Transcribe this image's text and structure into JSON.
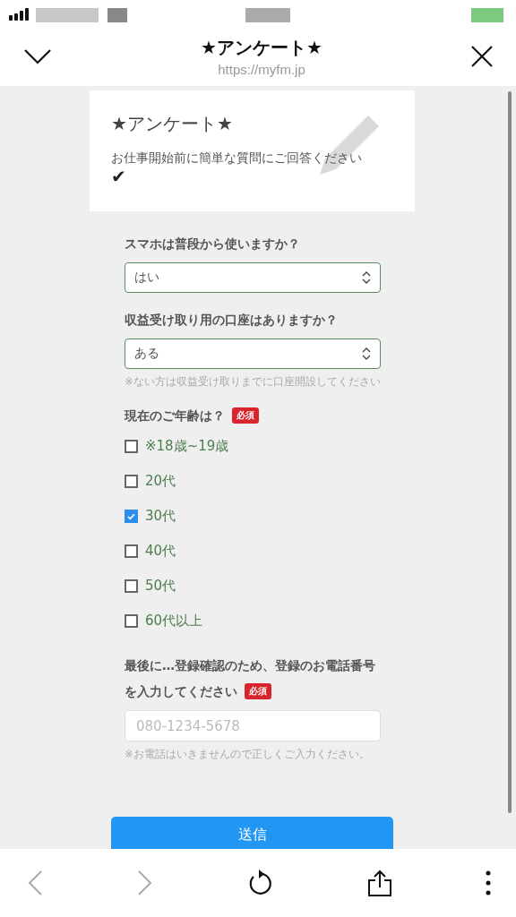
{
  "header": {
    "title": "★アンケート★",
    "url": "https://myfm.jp"
  },
  "intro": {
    "title": "★アンケート★",
    "text": "お仕事開始前に簡単な質問にご回答ください",
    "mark": "✔"
  },
  "questions": [
    {
      "kind": "select",
      "label": "スマホは普段から使いますか？",
      "value": "はい"
    },
    {
      "kind": "select",
      "label": "収益受け取り用の口座はありますか？",
      "value": "ある",
      "note": "※ない方は収益受け取りまでに口座開設してください"
    },
    {
      "kind": "checkboxes",
      "label": "現在のご年齢は？",
      "badge": "必須",
      "options": [
        {
          "label": "※18歳~19歳",
          "checked": false
        },
        {
          "label": "20代",
          "checked": false
        },
        {
          "label": "30代",
          "checked": true
        },
        {
          "label": "40代",
          "checked": false
        },
        {
          "label": "50代",
          "checked": false
        },
        {
          "label": "60代以上",
          "checked": false
        }
      ]
    },
    {
      "kind": "text",
      "label": "最後に…登録確認のため、登録のお電話番号を入力してください",
      "badge": "必須",
      "placeholder": "080-1234-5678",
      "note": "※お電話はいきませんので正しくご入力ください。"
    }
  ],
  "submit": "送信"
}
